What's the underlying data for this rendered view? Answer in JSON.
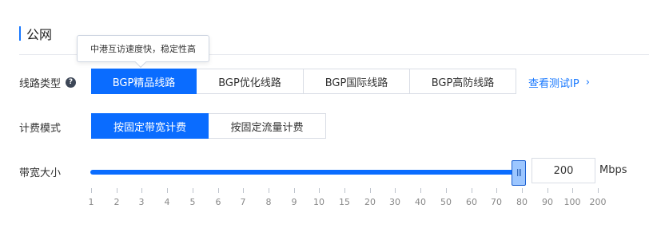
{
  "section": {
    "title": "公网"
  },
  "tooltip": {
    "text": "中港互访速度快，稳定性高"
  },
  "line_type": {
    "label": "线路类型",
    "help_glyph": "?",
    "options": [
      "BGP精品线路",
      "BGP优化线路",
      "BGP国际线路",
      "BGP高防线路"
    ],
    "selected": "BGP精品线路",
    "link_label": "查看测试IP",
    "link_chevron": "›"
  },
  "billing": {
    "label": "计费模式",
    "options": [
      "按固定带宽计费",
      "按固定流量计费"
    ],
    "selected": "按固定带宽计费"
  },
  "bandwidth": {
    "label": "带宽大小",
    "value": "200",
    "unit": "Mbps",
    "handle_glyph": "|||",
    "level": 1.0,
    "ticks": [
      "1",
      "2",
      "3",
      "4",
      "5",
      "6",
      "7",
      "8",
      "9",
      "10",
      "15",
      "20",
      "30",
      "40",
      "50",
      "60",
      "70",
      "80",
      "90",
      "100",
      "200"
    ]
  },
  "colors": {
    "accent": "#0a6cff",
    "link": "#1677ff"
  }
}
